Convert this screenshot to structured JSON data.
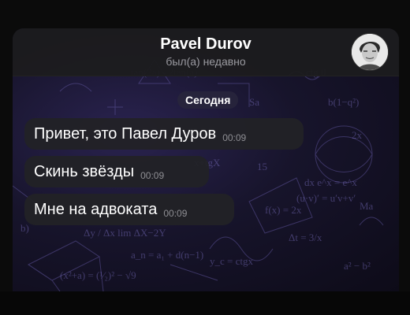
{
  "header": {
    "title": "Pavel Durov",
    "status": "был(а) недавно"
  },
  "date_separator": "Сегодня",
  "messages": [
    {
      "text": "Привет, это Павел Дуров",
      "time": "00:09"
    },
    {
      "text": "Скинь звёзды",
      "time": "00:09"
    },
    {
      "text": "Мне на адвоката",
      "time": "00:09"
    }
  ],
  "colors": {
    "header_bg": "#1c1c1e",
    "bubble_bg": "#222226",
    "time_text": "#8e8e93"
  }
}
